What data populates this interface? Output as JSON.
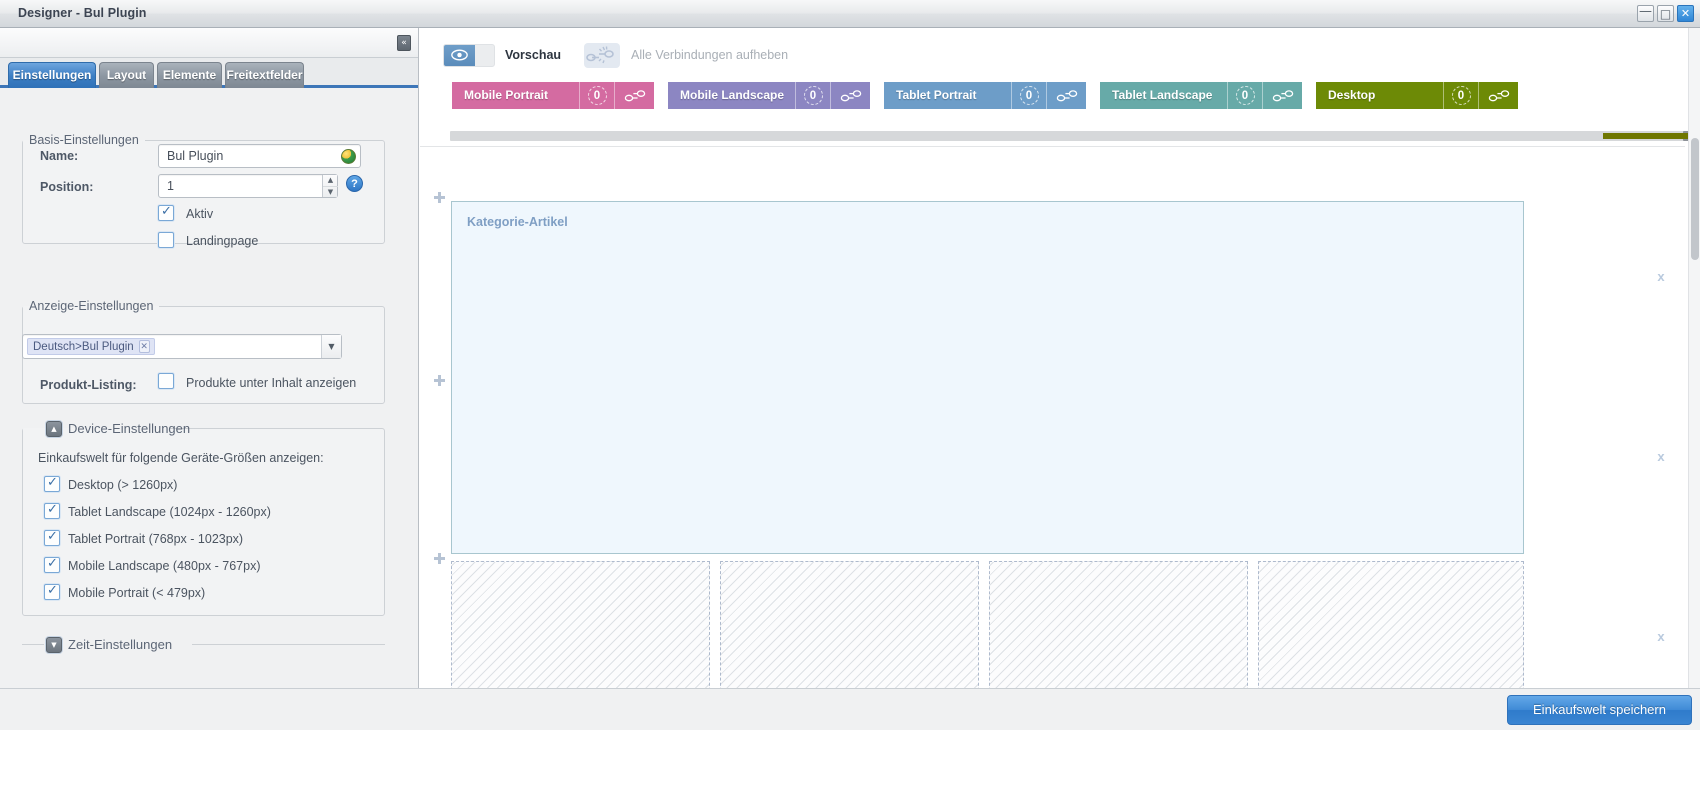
{
  "window": {
    "title": "Designer - Bul Plugin",
    "controls": [
      {
        "name": "minimize",
        "glyph": "—"
      },
      {
        "name": "maximize",
        "glyph": "□"
      },
      {
        "name": "close",
        "glyph": "✕"
      }
    ]
  },
  "left_panel": {
    "collapse_glyph": "«",
    "tabs": [
      {
        "label": "Einstellungen",
        "active": true
      },
      {
        "label": "Layout",
        "active": false
      },
      {
        "label": "Elemente",
        "active": false
      },
      {
        "label": "Freitextfelder",
        "active": false
      }
    ],
    "basis": {
      "legend": "Basis-Einstellungen",
      "name_label": "Name:",
      "name_value": "Bul Plugin",
      "position_label": "Position:",
      "position_value": "1",
      "help_glyph": "?",
      "spin_up": "▲",
      "spin_down": "▼",
      "aktiv_label": "Aktiv",
      "aktiv_checked": true,
      "landingpage_label": "Landingpage",
      "landingpage_checked": false
    },
    "anzeige": {
      "legend": "Anzeige-Einstellungen",
      "tag_label": "Deutsch>Bul Plugin",
      "tag_remove_glyph": "✕",
      "dropdown_glyph": "▼",
      "produkt_listing_label": "Produkt-Listing:",
      "produkt_listing_checkbox_label": "Produkte unter Inhalt anzeigen",
      "produkt_listing_checked": false
    },
    "device": {
      "legend": "Device-Einstellungen",
      "toggle_glyph": "▲",
      "intro": "Einkaufswelt für folgende Geräte-Größen anzeigen:",
      "items": [
        {
          "label": "Desktop (> 1260px)",
          "checked": true
        },
        {
          "label": "Tablet Landscape (1024px - 1260px)",
          "checked": true
        },
        {
          "label": "Tablet Portrait (768px - 1023px)",
          "checked": true
        },
        {
          "label": "Mobile Landscape (480px - 767px)",
          "checked": true
        },
        {
          "label": "Mobile Portrait (< 479px)",
          "checked": true
        }
      ]
    },
    "zeit": {
      "legend": "Zeit-Einstellungen",
      "toggle_glyph": "▼"
    }
  },
  "preview_bar": {
    "eye_icon": "eye-icon",
    "preview_label": "Vorschau",
    "unlink_icon": "unlink-icon",
    "unlink_label": "Alle Verbindungen aufheben"
  },
  "device_tabs": [
    {
      "label": "Mobile Portrait",
      "count": "0",
      "color": "#d46ba1"
    },
    {
      "label": "Mobile Landscape",
      "count": "0",
      "color": "#8c86c2"
    },
    {
      "label": "Tablet Portrait",
      "count": "0",
      "color": "#6d9dc8"
    },
    {
      "label": "Tablet Landscape",
      "count": "0",
      "color": "#67aaa8"
    },
    {
      "label": "Desktop",
      "count": "0",
      "color": "#6d8a06"
    }
  ],
  "canvas": {
    "element_title": "Kategorie-Artikel",
    "remove_marker": "x",
    "add_handle": "plus-icon"
  },
  "bottom_bar": {
    "save_label": "Einkaufswelt speichern"
  },
  "colors": {
    "accent_blue": "#3d7fc4",
    "active_tab": "#3d76b8",
    "element_fill": "#eff7fd",
    "element_border": "#a8c6cf",
    "desktop_tab": "#6d8a06"
  }
}
